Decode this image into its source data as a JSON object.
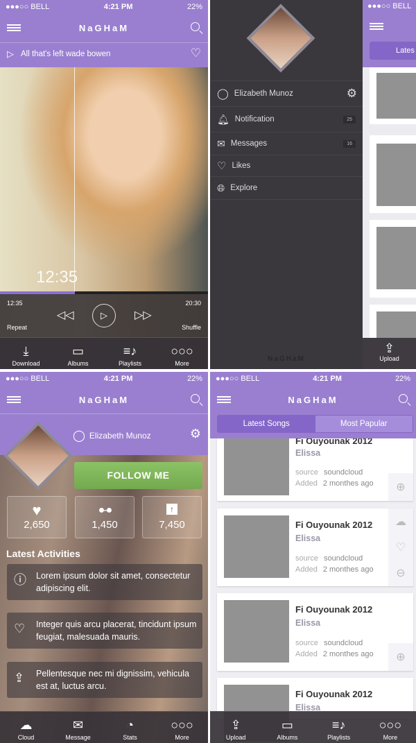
{
  "status": {
    "carrier": "●●●○○ BELL",
    "time": "4:21 PM",
    "battery": "22%"
  },
  "app_title": "NaGHaM",
  "player": {
    "now_playing": "All that's left wade bowen",
    "overlay_time": "12:35",
    "elapsed": "12:35",
    "total": "20:30",
    "progress_pct": 36,
    "repeat": "Repeat",
    "shuffle": "Shuffle",
    "tabs": [
      {
        "label": "Download",
        "icon": "download-icon"
      },
      {
        "label": "Albums",
        "icon": "albums-icon"
      },
      {
        "label": "Playlists",
        "icon": "playlist-icon"
      },
      {
        "label": "More",
        "icon": "more-icon"
      }
    ]
  },
  "drawer": {
    "user": "Elizabeth Munoz",
    "items": [
      {
        "label": "Notification",
        "badge": "25"
      },
      {
        "label": "Messages",
        "badge": "16"
      },
      {
        "label": "Likes"
      },
      {
        "label": "Explore"
      }
    ],
    "footer": "NaGHaM",
    "peek_tab": "Lates",
    "peek_bottom": "Upload"
  },
  "profile": {
    "name": "Elizabeth Munoz",
    "follow": "FOLLOW ME",
    "stats": [
      {
        "icon": "heart-icon",
        "value": "2,650"
      },
      {
        "icon": "glasses-icon",
        "value": "1,450"
      },
      {
        "icon": "upload-icon",
        "value": "7,450"
      }
    ],
    "activities_title": "Latest Activities",
    "activities": [
      "Lorem ipsum dolor sit amet, consectetur adipiscing elit.",
      "Integer quis arcu placerat, tincidunt ipsum feugiat, malesuada mauris.",
      "Pellentesque nec mi dignissim, vehicula est at, luctus arcu."
    ],
    "tabs": [
      {
        "label": "Cloud"
      },
      {
        "label": "Message"
      },
      {
        "label": "Stats"
      },
      {
        "label": "More"
      }
    ]
  },
  "songs": {
    "tabs": [
      "Latest Songs",
      "Most Papular"
    ],
    "items": [
      {
        "title": "Fi Ouyounak 2012",
        "artist": "Elissa",
        "source_label": "source",
        "source": "soundcloud",
        "added_label": "Added",
        "added": "2 monthes ago"
      },
      {
        "title": "Fi Ouyounak 2012",
        "artist": "Elissa",
        "source_label": "source",
        "source": "soundcloud",
        "added_label": "Added",
        "added": "2 monthes ago"
      },
      {
        "title": "Fi Ouyounak 2012",
        "artist": "Elissa",
        "source_label": "source",
        "source": "soundcloud",
        "added_label": "Added",
        "added": "2 monthes ago"
      },
      {
        "title": "Fi Ouyounak 2012",
        "artist": "Elissa"
      }
    ],
    "bottom_tabs": [
      {
        "label": "Upload"
      },
      {
        "label": "Albums"
      },
      {
        "label": "Playlists"
      },
      {
        "label": "More"
      }
    ]
  },
  "colors": {
    "accent": "#9a7fd0",
    "follow": "#7db55a",
    "dark": "#3a373d"
  }
}
